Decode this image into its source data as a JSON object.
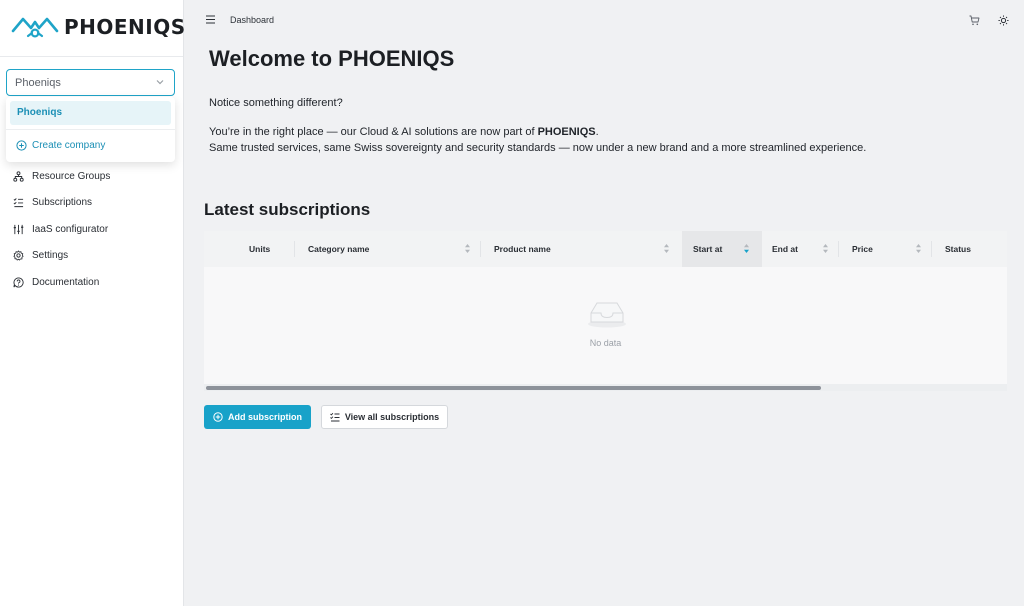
{
  "brand": {
    "name": "PHOENIQS",
    "accent": "#18a2c9"
  },
  "sidebar": {
    "company_select": {
      "value": "Phoeniqs",
      "icon": "chevron-down-icon"
    },
    "dropdown": {
      "options": [
        {
          "label": "Phoeniqs",
          "selected": true
        }
      ],
      "create_label": "Create company",
      "create_icon": "plus-circle-icon"
    },
    "items": [
      {
        "label": "Resource Groups",
        "icon": "hierarchy-icon"
      },
      {
        "label": "Subscriptions",
        "icon": "checklist-icon"
      },
      {
        "label": "IaaS configurator",
        "icon": "sliders-icon"
      },
      {
        "label": "Settings",
        "icon": "gear-icon"
      },
      {
        "label": "Documentation",
        "icon": "help-icon"
      }
    ]
  },
  "topbar": {
    "breadcrumb": "Dashboard",
    "menu_icon": "hamburger-icon",
    "cart_icon": "cart-icon",
    "theme_icon": "sun-icon"
  },
  "main": {
    "title": "Welcome to PHOENIQS",
    "notice": "Notice something different?",
    "intro": {
      "line1_prefix": "You’re in the right place — our Cloud & AI solutions are now part of ",
      "line1_brand": "PHOENIQS",
      "line1_suffix": ".",
      "line2": "Same trusted services, same Swiss sovereignty and security standards — now under a new brand and a more streamlined experience."
    }
  },
  "subscriptions": {
    "title": "Latest subscriptions",
    "columns": [
      {
        "label": "Units",
        "sortable": false
      },
      {
        "label": "Category name",
        "sortable": true
      },
      {
        "label": "Product name",
        "sortable": true
      },
      {
        "label": "Start at",
        "sortable": true,
        "sort": "descending"
      },
      {
        "label": "End at",
        "sortable": true
      },
      {
        "label": "Price",
        "sortable": true
      },
      {
        "label": "Status",
        "sortable": false
      }
    ],
    "rows": [],
    "empty_text": "No data",
    "horizontal_scroll_fraction": 0.77
  },
  "actions": {
    "add_label": "Add subscription",
    "view_all_label": "View all subscriptions"
  }
}
